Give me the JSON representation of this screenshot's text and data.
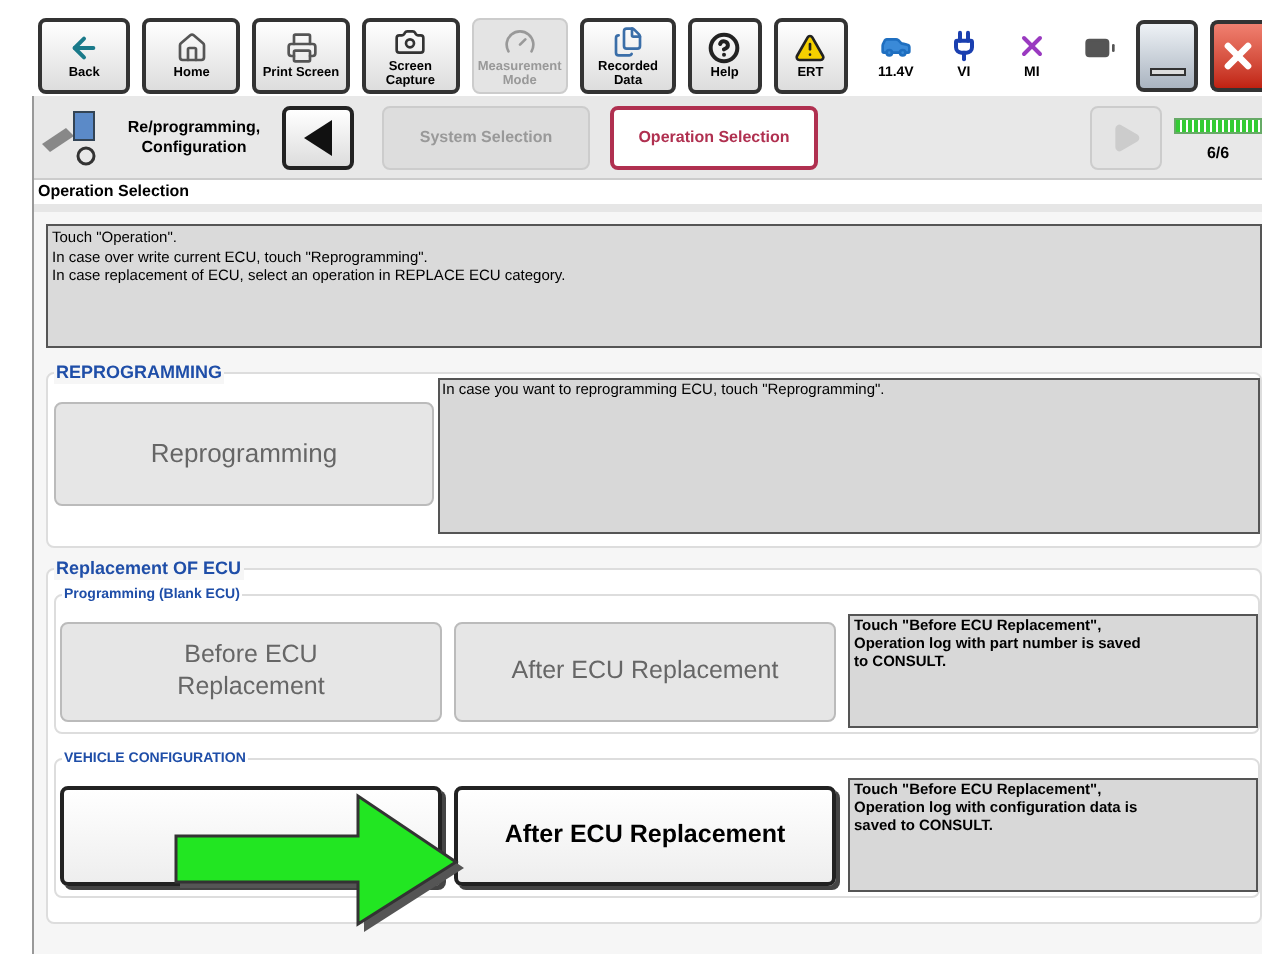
{
  "toolbar": {
    "buttons": [
      {
        "label": "Back",
        "disabled": false
      },
      {
        "label": "Home",
        "disabled": false
      },
      {
        "label": "Print Screen",
        "disabled": false
      },
      {
        "label": "Screen Capture",
        "disabled": false
      },
      {
        "label": "Measurement Mode",
        "disabled": true
      },
      {
        "label": "Recorded Data",
        "disabled": false
      },
      {
        "label": "Help",
        "disabled": false
      },
      {
        "label": "ERT",
        "disabled": false
      }
    ],
    "status": [
      {
        "label": "11.4V"
      },
      {
        "label": "VI"
      },
      {
        "label": "MI"
      }
    ]
  },
  "navigation": {
    "title": "Re/programming, Configuration",
    "steps": [
      {
        "label": "System Selection",
        "selected": false
      },
      {
        "label": "Operation Selection",
        "selected": true
      }
    ],
    "progress": {
      "label": "6/6",
      "level": 1
    }
  },
  "page_title": "Operation Selection",
  "instructions": [
    "Touch  \"Operation\".",
    "In case over write current ECU, touch \"Reprogramming\".",
    "In case replacement of ECU, select an operation in REPLACE ECU category."
  ],
  "reprogramming": {
    "title": "REPROGRAMMING",
    "button": {
      "label": "Reprogramming",
      "disabled": true
    },
    "description": "In case you want to reprogramming ECU, touch \"Reprogramming\"."
  },
  "replacement": {
    "title": "Replacement OF ECU",
    "groups": [
      {
        "title": "Programming (Blank ECU)",
        "buttons": [
          {
            "label": "Before ECU\nReplacement",
            "disabled": true
          },
          {
            "label": "After ECU Replacement",
            "disabled": true
          }
        ],
        "description": "Touch \"Before ECU Replacement\",\nOperation log with part number is saved\nto CONSULT."
      },
      {
        "title": "VEHICLE CONFIGURATION",
        "buttons": [
          {
            "disabled": false
          },
          {
            "label": "After ECU Replacement",
            "disabled": false
          }
        ],
        "description": "Touch \"Before ECU Replacement\",\nOperation log with configuration data is\nsaved to CONSULT."
      }
    ]
  }
}
